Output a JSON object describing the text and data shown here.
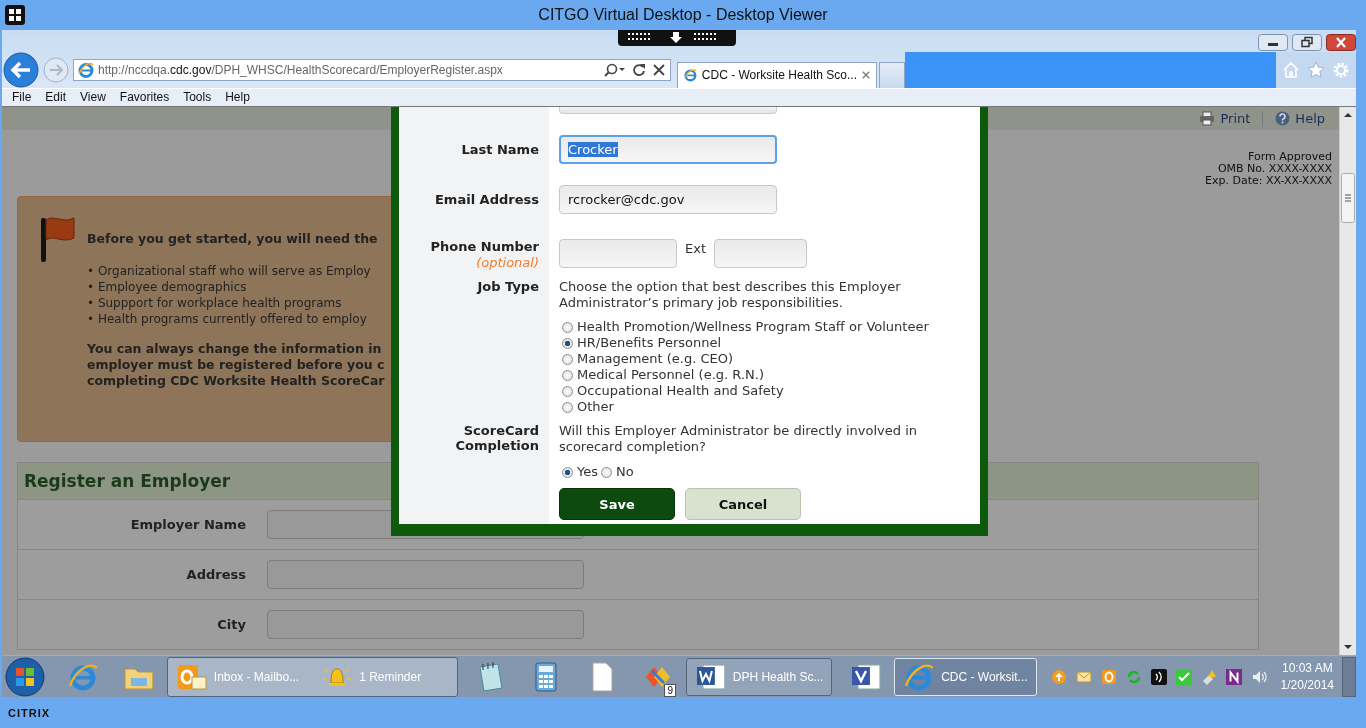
{
  "window": {
    "title": "CITGO Virtual Desktop - Desktop Viewer"
  },
  "browser": {
    "address": {
      "scheme": "http://nccdqa.",
      "domain": "cdc.gov",
      "path": "/DPH_WHSC/HealthScorecard/EmployerRegister.aspx"
    },
    "tabs": [
      {
        "label": "CDC - Worksite Health Sco...",
        "selected": true
      }
    ],
    "menu": [
      "File",
      "Edit",
      "View",
      "Favorites",
      "Tools",
      "Help"
    ]
  },
  "page": {
    "toolbar": [
      {
        "kind": "print",
        "label": "Print"
      },
      {
        "kind": "help",
        "label": "Help"
      }
    ],
    "form_notice": [
      "Form Approved",
      "OMB No. XXXX-XXXX",
      "Exp. Date: XX-XX-XXXX"
    ],
    "notice_box": {
      "heading": "Before you get started, you will need the",
      "bullets": [
        "• Organizational staff who will serve as Employ",
        "• Employee demographics",
        "• Suppport for workplace health programs",
        "• Health programs currently offered to employ"
      ],
      "note": [
        "You can always change the information in",
        "employer must be registered before you c",
        "completing CDC Worksite Health ScoreCar"
      ]
    },
    "register": {
      "title": "Register an Employer",
      "fields": [
        {
          "label": "Employer Name"
        },
        {
          "label": "Address"
        },
        {
          "label": "City"
        }
      ]
    }
  },
  "dialog": {
    "fields": [
      {
        "kind": "text",
        "label": "Last Name",
        "value": "Crocker",
        "focused": true
      },
      {
        "kind": "text",
        "label": "Email Address",
        "value": "rcrocker@cdc.gov",
        "focused": false
      },
      {
        "kind": "phone",
        "label": "Phone Number",
        "hint": "(optional)",
        "ext_label": "Ext"
      },
      {
        "kind": "radio",
        "label": "Job Type",
        "description": "Choose the option that best describes this Employer Administrator’s primary job responsibilities.",
        "options": [
          {
            "label": "Health Promotion/Wellness Program Staff or Volunteer",
            "selected": false
          },
          {
            "label": "HR/Benefits Personnel",
            "selected": true
          },
          {
            "label": "Management (e.g. CEO)",
            "selected": false
          },
          {
            "label": "Medical Personnel (e.g. R.N.)",
            "selected": false
          },
          {
            "label": "Occupational Health and Safety",
            "selected": false
          },
          {
            "label": "Other",
            "selected": false
          }
        ]
      },
      {
        "kind": "radio",
        "label": "ScoreCard Completion",
        "description": "Will this Employer Administrator be directly involved in scorecard completion?",
        "options": [
          {
            "label": "Yes",
            "selected": true
          },
          {
            "label": "No",
            "selected": false
          }
        ]
      }
    ],
    "buttons": [
      {
        "kind": "primary",
        "label": "Save"
      },
      {
        "kind": "secondary",
        "label": "Cancel"
      }
    ]
  },
  "taskbar": {
    "buttons": [
      {
        "label": "Inbox - Mailbo...",
        "selected": false
      },
      {
        "label": "1 Reminder",
        "selected": false
      },
      {
        "label": "DPH Health Sc...",
        "selected": false
      },
      {
        "label": "CDC - Worksit...",
        "selected": true
      }
    ],
    "badge": "9",
    "clock": {
      "time": "10:03 AM",
      "date": "1/20/2014"
    }
  },
  "brand": "CITRIX"
}
